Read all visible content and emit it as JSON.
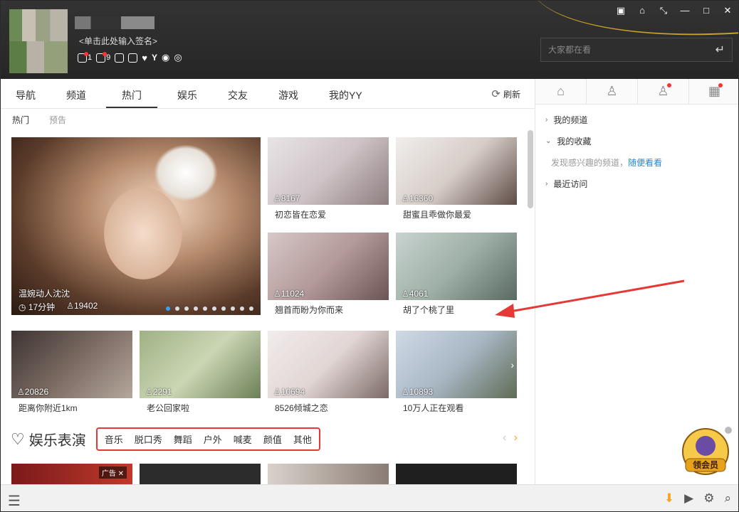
{
  "header": {
    "signature": "<单击此处输入签名>",
    "badges": {
      "b1": "1",
      "b2": "9"
    },
    "search_placeholder": "大家都在看"
  },
  "tabs": [
    "导航",
    "频道",
    "热门",
    "娱乐",
    "交友",
    "游戏",
    "我的YY"
  ],
  "refresh_label": "刷新",
  "subtabs": [
    "热门",
    "预告"
  ],
  "featured": {
    "title": "温婉动人沈沈",
    "duration": "17分钟",
    "viewers": "19402"
  },
  "cards": [
    {
      "viewers": "8167",
      "title": "初恋皆在恋爱"
    },
    {
      "viewers": "16360",
      "title": "甜蜜且乖做你最爱"
    },
    {
      "viewers": "11024",
      "title": "翘首而盼为你而来"
    },
    {
      "viewers": "4061",
      "title": "胡了个桃了里"
    },
    {
      "viewers": "20826",
      "title": "距离你附近1km"
    },
    {
      "viewers": "2291",
      "title": "老公回家啦"
    },
    {
      "viewers": "10694",
      "title": "8526倾城之恋"
    },
    {
      "viewers": "10893",
      "title": "10万人正在观看"
    }
  ],
  "section": {
    "title": "娱乐表演",
    "categories": [
      "音乐",
      "脱口秀",
      "舞蹈",
      "户外",
      "喊麦",
      "颜值",
      "其他"
    ],
    "ad_label": "广告"
  },
  "sidebar": {
    "my_channels": "我的频道",
    "my_favorites": "我的收藏",
    "hint_text": "发现感兴趣的频道，",
    "hint_link": "随便看看",
    "recent": "最近访问"
  },
  "mascot_text": "领会员",
  "colors": {
    "accent": "#37a2f5",
    "highlight": "#e53935",
    "header_bg": "#2b2b2b"
  }
}
